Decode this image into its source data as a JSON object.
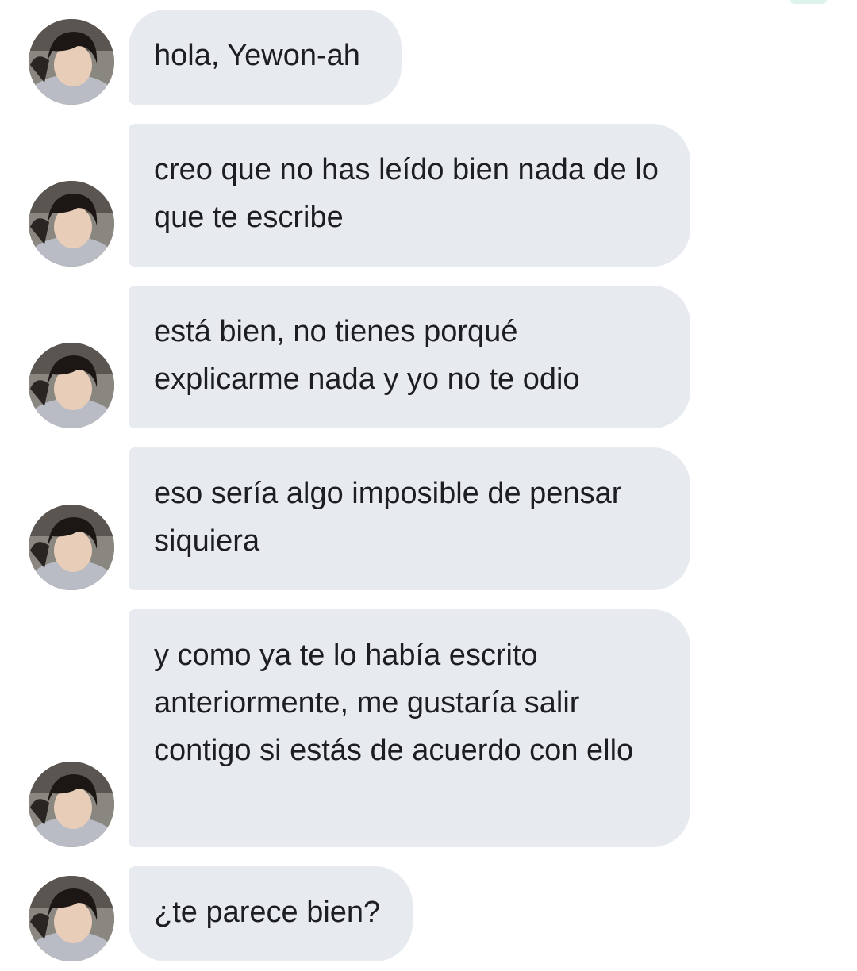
{
  "chat": {
    "messages": [
      {
        "text": "hola, Yewon-ah"
      },
      {
        "text": "creo que no has leído bien nada de lo que te escribe"
      },
      {
        "text": "está bien, no tienes porqué explicarme nada y yo no te odio"
      },
      {
        "text": "eso sería algo imposible de pensar siquiera"
      },
      {
        "text": "y como ya te lo había escrito anteriormente, me gustaría salir contigo si estás de acuerdo con ello"
      },
      {
        "text": "¿te parece bien?"
      }
    ]
  },
  "colors": {
    "bubble_background": "#e7ebf0",
    "text": "#1c1e21",
    "page_background": "#ffffff"
  }
}
